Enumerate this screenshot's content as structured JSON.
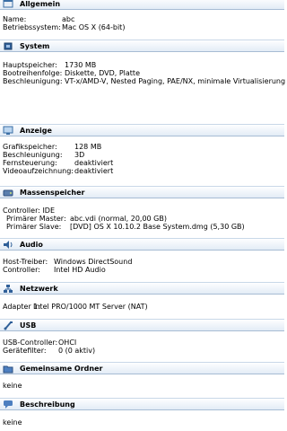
{
  "sections": {
    "allgemein": {
      "title": "Allgemein",
      "icon": "general-settings-icon",
      "rows": [
        {
          "key": "Name:",
          "value": "abc"
        },
        {
          "key": "Betriebssystem:",
          "value": "Mac OS X (64-bit)"
        }
      ]
    },
    "system": {
      "title": "System",
      "icon": "chip-icon",
      "rows": [
        {
          "key": "Hauptspeicher:",
          "value": "1730 MB"
        },
        {
          "key": "Bootreihenfolge:",
          "value": "Diskette, DVD, Platte"
        },
        {
          "key": "Beschleunigung:",
          "value": "VT-x/AMD-V, Nested Paging, PAE/NX, minimale Virtualisierung"
        }
      ]
    },
    "anzeige": {
      "title": "Anzeige",
      "icon": "monitor-icon",
      "rows": [
        {
          "key": "Grafikspeicher:",
          "value": "128 MB"
        },
        {
          "key": "Beschleunigung:",
          "value": "3D"
        },
        {
          "key": "Fernsteuerung:",
          "value": "deaktiviert"
        },
        {
          "key": "Videoaufzeichnung:",
          "value": "deaktiviert"
        }
      ]
    },
    "massenspeicher": {
      "title": "Massenspeicher",
      "icon": "hard-disk-icon",
      "controller": "Controller: IDE",
      "rows": [
        {
          "key": "Primärer Master:",
          "value": "abc.vdi (normal, 20,00 GB)"
        },
        {
          "key": "Primärer Slave:",
          "value": "[DVD] OS X 10.10.2 Base System.dmg (5,30 GB)"
        }
      ]
    },
    "audio": {
      "title": "Audio",
      "icon": "speaker-icon",
      "rows": [
        {
          "key": "Host-Treiber:",
          "value": "Windows DirectSound"
        },
        {
          "key": "Controller:",
          "value": "Intel HD Audio"
        }
      ]
    },
    "netzwerk": {
      "title": "Netzwerk",
      "icon": "network-icon",
      "rows": [
        {
          "key": "Adapter 1:",
          "value": "Intel PRO/1000 MT Server (NAT)"
        }
      ]
    },
    "usb": {
      "title": "USB",
      "icon": "usb-icon",
      "rows": [
        {
          "key": "USB-Controller:",
          "value": "OHCI"
        },
        {
          "key": "Gerätefilter:",
          "value": "0 (0 aktiv)"
        }
      ]
    },
    "ordner": {
      "title": "Gemeinsame Ordner",
      "icon": "folder-icon",
      "text": "keine"
    },
    "beschreibung": {
      "title": "Beschreibung",
      "icon": "speech-bubble-icon",
      "text": "keine"
    }
  },
  "colors": {
    "header_gradient_top": "#fdfeff",
    "header_gradient_bottom": "#e3ecf6",
    "header_border": "#a7bcd4"
  }
}
